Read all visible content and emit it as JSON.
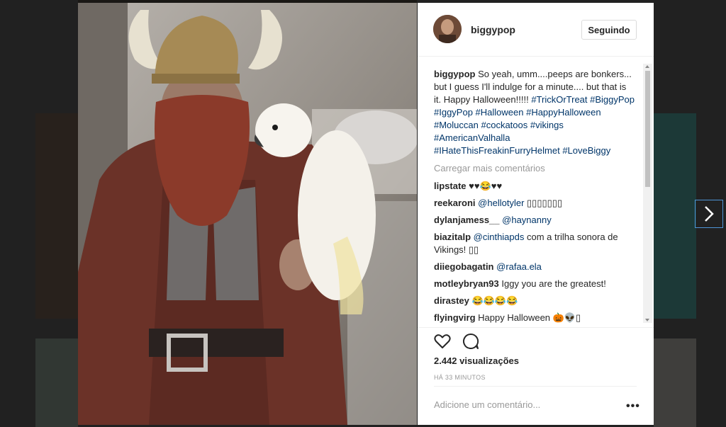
{
  "post": {
    "username": "biggypop",
    "follow_label": "Seguindo",
    "caption": {
      "user": "biggypop",
      "text": "So yeah, umm....peeps are bonkers... but I guess I'll indulge for a minute.... but that is it. Happy Halloween!!!!!",
      "hashtags": "#TrickOrTreat #BiggyPop #IggyPop #Halloween #HappyHalloween #Moluccan #cockatoos #vikings #AmericanValhalla #IHateThisFreakinFurryHelmet #LoveBiggy"
    },
    "load_more": "Carregar mais comentários",
    "comments": [
      {
        "user": "lipstate",
        "mention": "",
        "text": "♥♥😂♥♥"
      },
      {
        "user": "reekaroni",
        "mention": "@hellotyler",
        "text": "▯▯▯▯▯▯▯"
      },
      {
        "user": "dylanjamess__",
        "mention": "@haynanny",
        "text": ""
      },
      {
        "user": "biazitalp",
        "mention": "@cinthiapds",
        "text": "com a trilha sonora de Vikings! ▯▯"
      },
      {
        "user": "diiegobagatin",
        "mention": "@rafaa.ela",
        "text": ""
      },
      {
        "user": "motleybryan93",
        "mention": "",
        "text": "Iggy you are the greatest!"
      },
      {
        "user": "dirastey",
        "mention": "",
        "text": "😂😂😂😂"
      },
      {
        "user": "flyingvirg",
        "mention": "",
        "text": "Happy Halloween 🎃👽▯"
      }
    ],
    "views": "2.442 visualizações",
    "time_ago": "HÁ 33 MINUTOS",
    "add_comment_placeholder": "Adicione um comentário...",
    "more_options": "•••"
  },
  "icons": {
    "like": "heart-icon",
    "comment": "comment-bubble-icon",
    "next": "chevron-right-icon"
  },
  "colors": {
    "hashtag": "#003569",
    "accent_border": "#4e94d6"
  }
}
